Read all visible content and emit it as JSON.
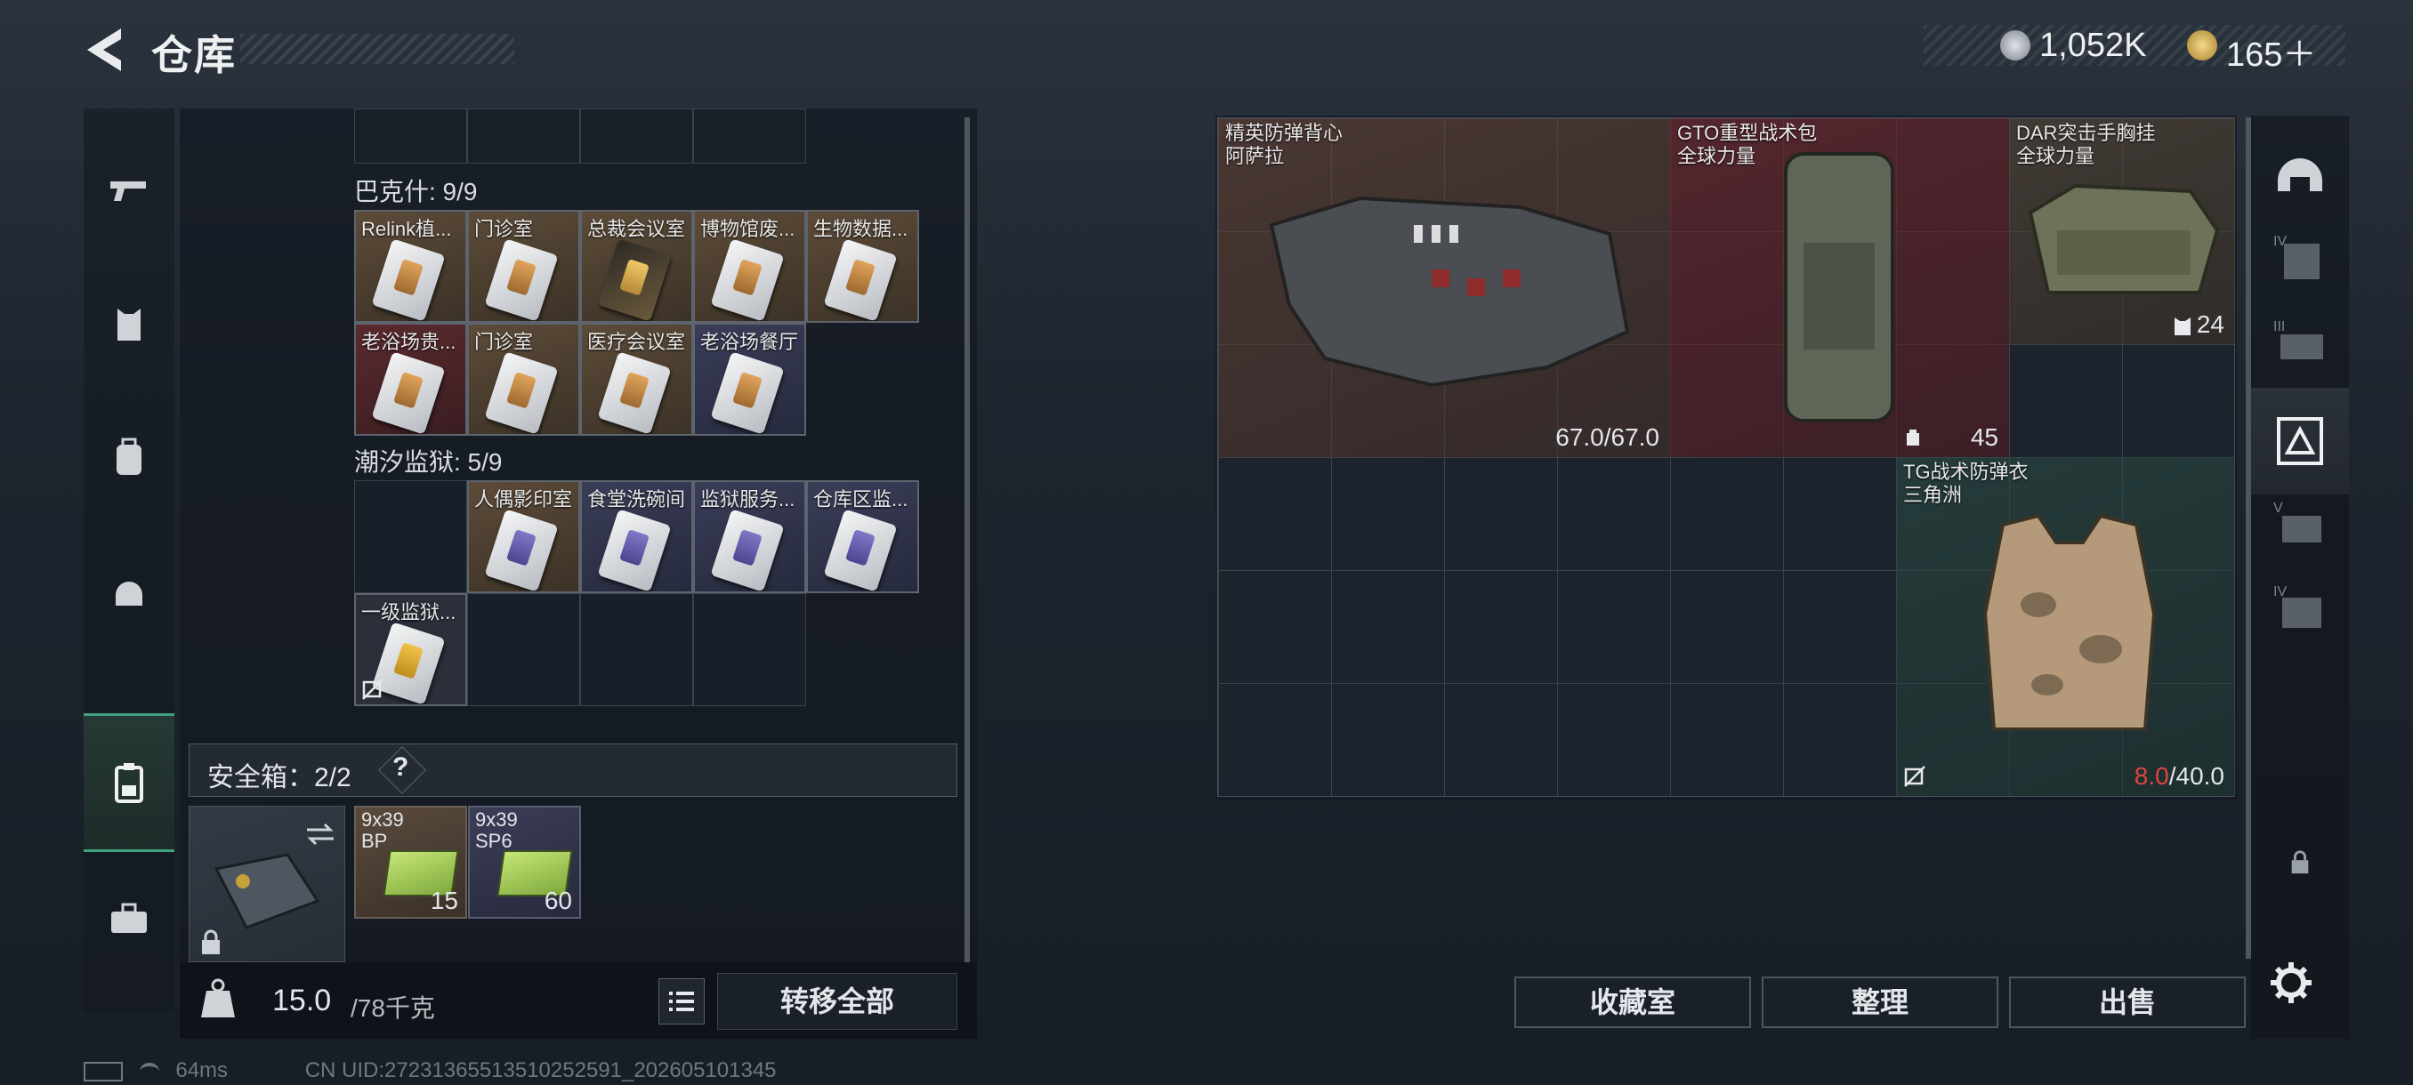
{
  "header": {
    "title": "仓库"
  },
  "currency": {
    "silver_value": "1,052K",
    "gold_value": "165＋"
  },
  "stash": {
    "groups": [
      {
        "label": "巴克什: 9/9",
        "items": [
          "Relink植...",
          "门诊室",
          "总裁会议室",
          "博物馆废...",
          "生物数据...",
          "老浴场贵...",
          "门诊室",
          "医疗会议室",
          "老浴场餐厅"
        ]
      },
      {
        "label": "潮汐监狱: 5/9",
        "items": [
          "人偶影印室",
          "食堂洗碗间",
          "监狱服务...",
          "仓库区监...",
          "一级监狱..."
        ]
      }
    ]
  },
  "safe_box": {
    "label": "安全箱：2/2",
    "help": "?",
    "ammo": [
      {
        "name_line1": "9x39",
        "name_line2": "BP",
        "count": "15"
      },
      {
        "name_line1": "9x39",
        "name_line2": "SP6",
        "count": "60"
      }
    ]
  },
  "weight": {
    "current": "15.0",
    "max": "/78千克"
  },
  "actions": {
    "transfer_all": "转移全部",
    "collection": "收藏室",
    "organize": "整理",
    "sell": "出售"
  },
  "equipment": [
    {
      "name": "精英防弹背心",
      "subtitle": "阿萨拉",
      "value": "67.0/67.0"
    },
    {
      "name": "GTO重型战术包",
      "subtitle": "全球力量",
      "value": "45"
    },
    {
      "name": "DAR突击手胸挂",
      "subtitle": "全球力量",
      "value": "24"
    },
    {
      "name": "TG战术防弹衣",
      "subtitle": "三角洲",
      "value_current": "8.0",
      "value_max": "/40.0"
    }
  ],
  "right_nav_labels": [
    "IV",
    "III",
    "V",
    "IV"
  ],
  "status": {
    "ping": "64ms",
    "uid": "CN UID:27231365513510252591_202605101345"
  },
  "colors": {
    "accent_green": "#3fa281",
    "danger_red": "#e0443e"
  }
}
